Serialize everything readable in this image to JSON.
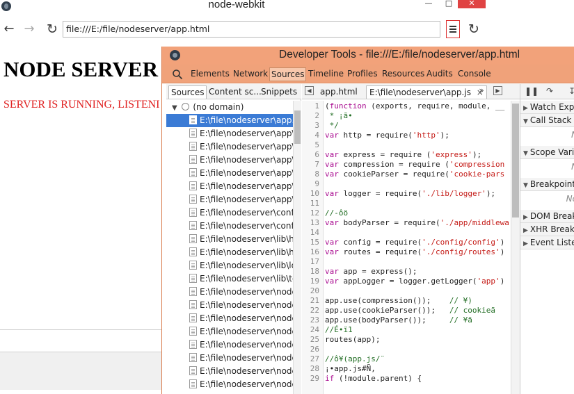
{
  "browser": {
    "title": "node-webkit",
    "window_controls": {
      "minimize": "—",
      "maximize": "□",
      "close": "✕"
    },
    "address": "file:///E:/file/nodeserver/app.html",
    "page": {
      "heading": "NODE SERVER",
      "status": "SERVER IS RUNNING, LISTENI"
    }
  },
  "devtools": {
    "title": "Developer Tools - file:///E:/file/nodeserver/app.html",
    "main_tabs": [
      "Elements",
      "Network",
      "Sources",
      "Timeline",
      "Profiles",
      "Resources",
      "Audits",
      "Console"
    ],
    "active_main_tab": "Sources",
    "navigator_tabs": [
      "Sources",
      "Content sc...",
      "Snippets"
    ],
    "tree_root": "(no domain)",
    "files": [
      "E:\\file\\nodeserver\\app.js",
      "E:\\file\\nodeserver\\app\\m",
      "E:\\file\\nodeserver\\app\\se",
      "E:\\file\\nodeserver\\app\\se",
      "E:\\file\\nodeserver\\app\\se",
      "E:\\file\\nodeserver\\app\\se",
      "E:\\file\\nodeserver\\app\\se",
      "E:\\file\\nodeserver\\config",
      "E:\\file\\nodeserver\\config",
      "E:\\file\\nodeserver\\lib\\htt",
      "E:\\file\\nodeserver\\lib\\htt",
      "E:\\file\\nodeserver\\lib\\log",
      "E:\\file\\nodeserver\\lib\\toc",
      "E:\\file\\nodeserver\\node_",
      "E:\\file\\nodeserver\\node_",
      "E:\\file\\nodeserver\\node_",
      "E:\\file\\nodeserver\\node_",
      "E:\\file\\nodeserver\\node_",
      "E:\\file\\nodeserver\\node_",
      "E:\\file\\nodeserver\\node_",
      "E:\\file\\nodeserver\\node_"
    ],
    "editor_tabs": [
      "app.html",
      "E:\\file\\nodeserver\\app.js"
    ],
    "editor_tab_close": "×",
    "code_lines": [
      {
        "n": "1",
        "text": "(function (exports, require, module, __"
      },
      {
        "n": "2",
        "text": " * ¡ã•"
      },
      {
        "n": "3",
        "text": " */"
      },
      {
        "n": "4",
        "text": "var http = require('http');"
      },
      {
        "n": "5",
        "text": ""
      },
      {
        "n": "6",
        "text": "var express = require ('express');"
      },
      {
        "n": "7",
        "text": "var compression = require ('compression"
      },
      {
        "n": "8",
        "text": "var cookieParser = require('cookie-pars"
      },
      {
        "n": "9",
        "text": ""
      },
      {
        "n": "10",
        "text": "var logger = require('./lib/logger');"
      },
      {
        "n": "11",
        "text": ""
      },
      {
        "n": "12",
        "text": "//-ôö"
      },
      {
        "n": "13",
        "text": "var bodyParser = require('./app/middlewa"
      },
      {
        "n": "14",
        "text": ""
      },
      {
        "n": "15",
        "text": "var config = require('./config/config')"
      },
      {
        "n": "16",
        "text": "var routes = require('./config/routes')"
      },
      {
        "n": "17",
        "text": ""
      },
      {
        "n": "18",
        "text": "var app = express();"
      },
      {
        "n": "19",
        "text": "var appLogger = logger.getLogger('app')"
      },
      {
        "n": "20",
        "text": ""
      },
      {
        "n": "21",
        "text": "app.use(compression());    // ¥)"
      },
      {
        "n": "22",
        "text": "app.use(cookieParser());   // cookieã"
      },
      {
        "n": "23",
        "text": "app.use(bodyParser());     // ¥ã"
      },
      {
        "n": "24",
        "text": "//É•ï1"
      },
      {
        "n": "25",
        "text": "routes(app);"
      },
      {
        "n": "26",
        "text": ""
      },
      {
        "n": "27",
        "text": "//ô¥(app.js/¨"
      },
      {
        "n": "28",
        "text": "¡•app.js#Ñ,"
      },
      {
        "n": "29",
        "text": "if (!module.parent) {"
      }
    ],
    "side_sections": [
      {
        "label": "Watch Expr",
        "expanded": false,
        "note": ""
      },
      {
        "label": "Call Stack",
        "expanded": true,
        "note": "N"
      },
      {
        "label": "Scope Varia",
        "expanded": true,
        "note": "N"
      },
      {
        "label": "Breakpoints",
        "expanded": true,
        "note": "No"
      },
      {
        "label": "DOM Break",
        "expanded": false,
        "note": ""
      },
      {
        "label": "XHR Break",
        "expanded": false,
        "note": ""
      },
      {
        "label": "Event Lister",
        "expanded": false,
        "note": ""
      }
    ],
    "colors": {
      "titlebar": "#f2a27a",
      "selection": "#3b7bd5",
      "keyword": "#aa0d91",
      "string": "#c41a16",
      "comment": "#236e25",
      "number": "#1c00cf"
    }
  }
}
